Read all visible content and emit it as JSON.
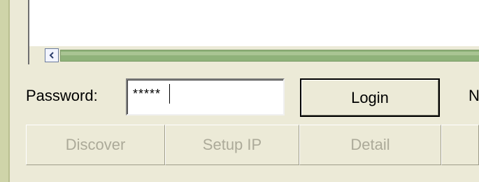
{
  "password_label": "Password:",
  "password_value": "*****",
  "login_label": "Login",
  "clipped_text": "N",
  "buttons": [
    "Discover",
    "Setup IP",
    "Detail",
    ""
  ]
}
